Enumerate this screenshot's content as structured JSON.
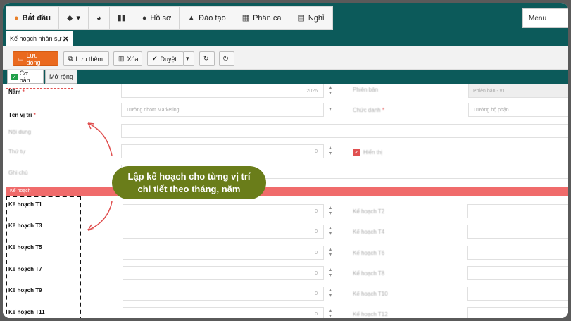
{
  "topmenu": [
    {
      "icon": "pumpkin-icon",
      "glyph": "●",
      "label": "Bắt đầu"
    },
    {
      "icon": "cube-icon",
      "glyph": "◆",
      "label": "▾"
    },
    {
      "icon": "dashboard-icon",
      "glyph": "◕",
      "label": ""
    },
    {
      "icon": "chart-icon",
      "glyph": "▮",
      "label": ""
    },
    {
      "icon": "user-icon",
      "glyph": "●",
      "label": "Hồ sơ"
    },
    {
      "icon": "graduation-cap-icon",
      "glyph": "▲",
      "label": "Đào tạo"
    },
    {
      "icon": "calendar-icon",
      "glyph": "▦",
      "label": "Phân ca"
    },
    {
      "icon": "id-card-icon",
      "glyph": "▤",
      "label": "Nghỉ"
    }
  ],
  "menu_placeholder": "Menu",
  "doc_tab": {
    "label": "Kế hoạch nhân sự",
    "close": "✕"
  },
  "toolbar": {
    "save": "Lưu đóng",
    "save_more": "Lưu thêm",
    "delete": "Xóa",
    "approve": "Duyệt",
    "approve_caret": "▾",
    "refresh": "↻",
    "power": "⏻"
  },
  "subtabs": {
    "basic": "Cơ bản",
    "expand": "Mở rộng"
  },
  "form": {
    "year_label": "Năm",
    "year_value": "2026",
    "position_label": "Tên vị trí",
    "position_value": "Trưởng nhóm Marketing",
    "content_label": "Nội dung",
    "order_label": "Thứ tự",
    "order_value": "0",
    "note_label": "Ghi chú",
    "version_label": "Phiên bản",
    "version_value": "Phiên bản - v1",
    "title_label": "Chức danh",
    "title_value": "Trưởng bộ phận",
    "active_label": "Hiển thị",
    "required_mark": "*",
    "section_label": "Kế hoạch"
  },
  "plan_rows": [
    {
      "left_label": "Kế hoạch T1",
      "left_value": "0",
      "right_label": "Kế hoạch T2",
      "right_value": ""
    },
    {
      "left_label": "Kế hoạch T3",
      "left_value": "0",
      "right_label": "Kế hoạch T4",
      "right_value": ""
    },
    {
      "left_label": "Kế hoạch T5",
      "left_value": "0",
      "right_label": "Kế hoạch T6",
      "right_value": ""
    },
    {
      "left_label": "Kế hoạch T7",
      "left_value": "0",
      "right_label": "Kế hoạch T8",
      "right_value": ""
    },
    {
      "left_label": "Kế hoạch T9",
      "left_value": "0",
      "right_label": "Kế hoạch T10",
      "right_value": ""
    },
    {
      "left_label": "Kế hoạch T11",
      "left_value": "0",
      "right_label": "Kế hoạch T12",
      "right_value": ""
    }
  ],
  "callout": {
    "line1": "Lập kế hoạch cho từng vị trí",
    "line2": "chi tiết theo tháng, năm"
  },
  "colors": {
    "brand": "#0c5a5a",
    "primary_button": "#ea6a1f",
    "callout": "#6a7d1a",
    "section": "#f06b6b"
  }
}
